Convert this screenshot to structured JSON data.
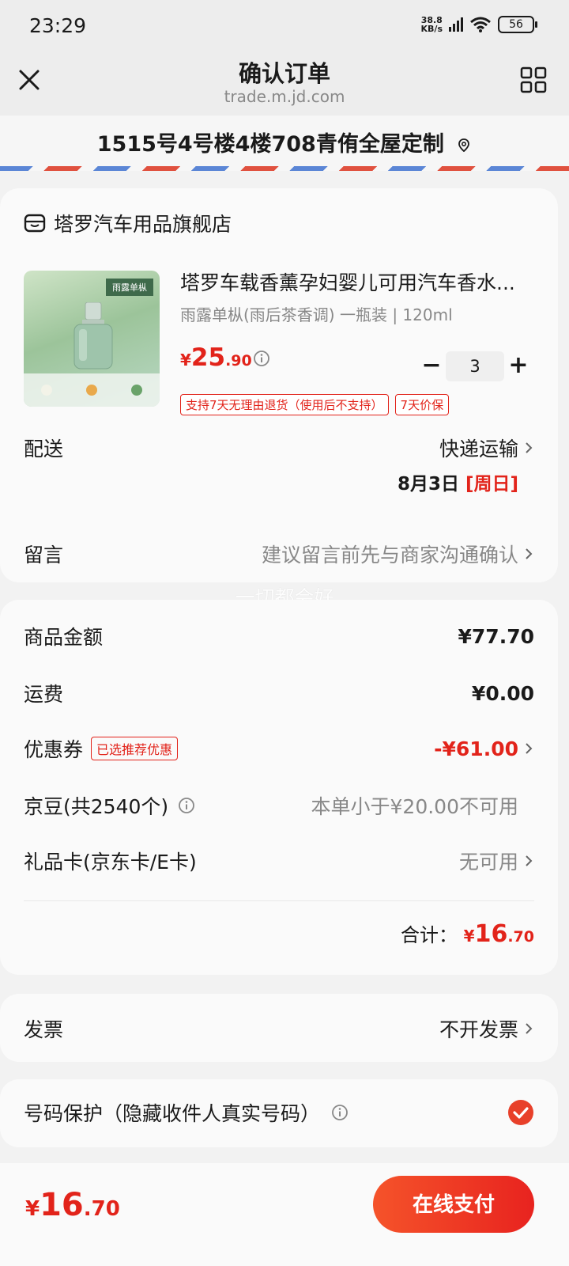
{
  "status": {
    "time": "23:29",
    "net_speed_value": "38.8",
    "net_speed_unit": "KB/s",
    "net_type": "HD",
    "battery": "56"
  },
  "header": {
    "title": "确认订单",
    "url": "trade.m.jd.com"
  },
  "address": {
    "text": "1515号4号楼4楼708青侑全屋定制"
  },
  "store": {
    "name": "塔罗汽车用品旗舰店"
  },
  "product": {
    "title": "塔罗车载香薰孕妇婴儿可用汽车香水...",
    "spec": "雨露单枞(雨后茶香调) 一瓶装 | 120ml",
    "price_symbol": "¥",
    "price_int": "25",
    "price_dec": ".90",
    "quantity": "3",
    "minus": "−",
    "plus": "+",
    "image_tag": "雨露单枞",
    "tags": [
      "支持7天无理由退货（使用后不支持）",
      "7天价保"
    ]
  },
  "delivery": {
    "label": "配送",
    "method": "快递运输",
    "date": "8月3日",
    "weekday": "[周日]"
  },
  "message": {
    "label": "留言",
    "placeholder": "建议留言前先与商家沟通确认"
  },
  "watermark": "一切都会好",
  "summary": {
    "goods_label": "商品金额",
    "goods_value": "¥77.70",
    "shipping_label": "运费",
    "shipping_value": "¥0.00",
    "coupon_label": "优惠券",
    "coupon_badge": "已选推荐优惠",
    "coupon_value": "-¥61.00",
    "jingdou_label": "京豆(共2540个)",
    "jingdou_value": "本单小于¥20.00不可用",
    "giftcard_label": "礼品卡(京东卡/E卡)",
    "giftcard_value": "无可用",
    "total_label": "合计：",
    "total_symbol": "¥",
    "total_int": "16",
    "total_dec": ".70"
  },
  "invoice": {
    "label": "发票",
    "value": "不开发票"
  },
  "privacy": {
    "label": "号码保护（隐藏收件人真实号码）",
    "checked": true
  },
  "bottom": {
    "price_symbol": "¥",
    "price_int": "16",
    "price_dec": ".70",
    "pay_label": "在线支付"
  },
  "colors": {
    "accent": "#e2231a",
    "pay_gradient_start": "#f5532a",
    "background": "#f2f2f2"
  }
}
